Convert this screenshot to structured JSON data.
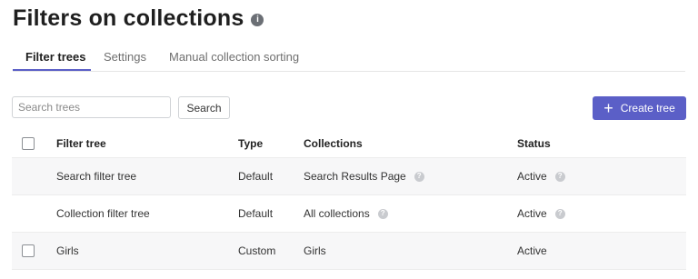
{
  "header": {
    "title": "Filters on collections",
    "info_icon": "info-icon"
  },
  "tabs": [
    {
      "label": "Filter trees",
      "active": true
    },
    {
      "label": "Settings",
      "active": false
    },
    {
      "label": "Manual collection sorting",
      "active": false
    }
  ],
  "toolbar": {
    "search_placeholder": "Search trees",
    "search_label": "Search",
    "create_label": "Create tree",
    "create_icon": "plus-icon"
  },
  "table": {
    "columns": [
      "Filter tree",
      "Type",
      "Collections",
      "Status"
    ],
    "rows": [
      {
        "name": "Search filter tree",
        "type": "Default",
        "collections": "Search Results Page",
        "collections_help": true,
        "status": "Active",
        "status_help": true,
        "checkbox": false
      },
      {
        "name": "Collection filter tree",
        "type": "Default",
        "collections": "All collections",
        "collections_help": true,
        "status": "Active",
        "status_help": true,
        "checkbox": false
      },
      {
        "name": "Girls",
        "type": "Custom",
        "collections": "Girls",
        "collections_help": false,
        "status": "Active",
        "status_help": false,
        "checkbox": true
      }
    ]
  },
  "colors": {
    "accent": "#5b5fc7",
    "text": "#222222",
    "muted": "#6f6f6f"
  }
}
